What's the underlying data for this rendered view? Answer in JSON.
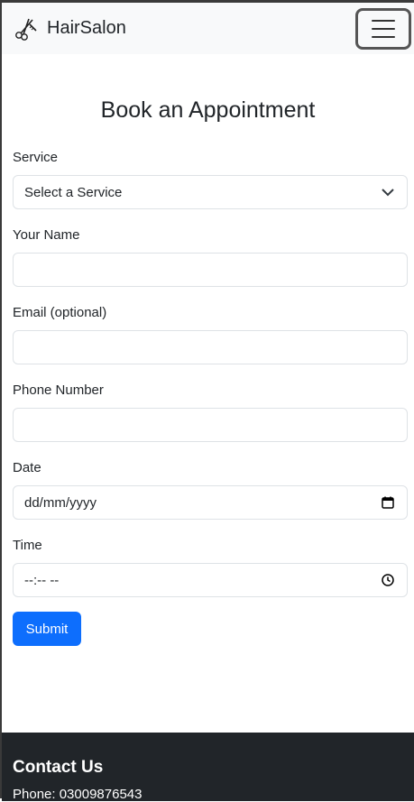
{
  "navbar": {
    "brand": "HairSalon",
    "brand_icon": "scissors-comb-icon",
    "toggle_icon": "hamburger-menu-icon"
  },
  "form": {
    "title": "Book an Appointment",
    "service": {
      "label": "Service",
      "value": "Select a Service"
    },
    "name": {
      "label": "Your Name",
      "value": ""
    },
    "email": {
      "label": "Email (optional)",
      "value": ""
    },
    "phone": {
      "label": "Phone Number",
      "value": ""
    },
    "date": {
      "label": "Date",
      "value": "dd/mm/yyyy"
    },
    "time": {
      "label": "Time",
      "value": "--:-- --"
    },
    "submit_label": "Submit"
  },
  "footer": {
    "title": "Contact Us",
    "phone": "Phone: 03009876543"
  },
  "colors": {
    "primary": "#0d6efd",
    "navbar_bg": "#f8f9fa",
    "footer_bg": "#212529"
  }
}
